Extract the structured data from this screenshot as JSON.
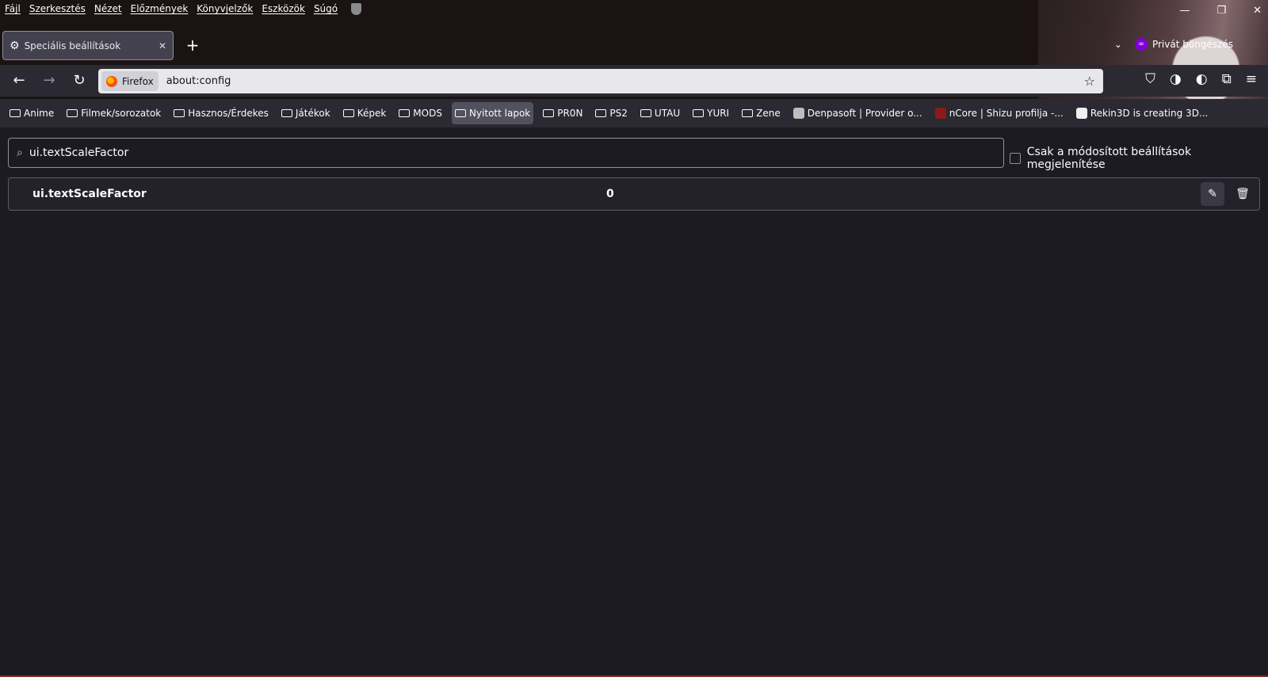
{
  "menubar": {
    "items": [
      "Fájl",
      "Szerkesztés",
      "Nézet",
      "Előzmények",
      "Könyvjelzők",
      "Eszközök",
      "Súgó"
    ]
  },
  "window_controls": {
    "minimize": "—",
    "restore": "❐",
    "close": "✕"
  },
  "tab": {
    "title": "Speciális beállítások",
    "close": "✕"
  },
  "newtab_label": "+",
  "private": {
    "label": "Privát böngészés",
    "chevron": "⌄",
    "mask_glyph": "∞"
  },
  "nav": {
    "back": "←",
    "forward": "→",
    "reload": "↻"
  },
  "urlbar": {
    "identity_label": "Firefox",
    "url": "about:config",
    "star": "☆"
  },
  "toolbar_right": {
    "pocket": "⛉",
    "ext1": "◑",
    "ext2": "◐",
    "extensions": "⧉",
    "menu": "≡"
  },
  "bookmarks": [
    {
      "label": "Anime",
      "type": "folder"
    },
    {
      "label": "Filmek/sorozatok",
      "type": "folder"
    },
    {
      "label": "Hasznos/Érdekes",
      "type": "folder"
    },
    {
      "label": "Játékok",
      "type": "folder"
    },
    {
      "label": "Képek",
      "type": "folder"
    },
    {
      "label": "MODS",
      "type": "folder"
    },
    {
      "label": "Nyitott lapok",
      "type": "folder",
      "active": true
    },
    {
      "label": "PR0N",
      "type": "folder"
    },
    {
      "label": "PS2",
      "type": "folder"
    },
    {
      "label": "UTAU",
      "type": "folder"
    },
    {
      "label": "YURI",
      "type": "folder"
    },
    {
      "label": "Zene",
      "type": "folder"
    },
    {
      "label": "Denpasoft | Provider o...",
      "type": "site",
      "color": "#bdbdbd"
    },
    {
      "label": "nCore | Shizu profilja -...",
      "type": "site",
      "color": "#8b1a1a"
    },
    {
      "label": "Rekin3D is creating 3D...",
      "type": "site",
      "color": "#f0f0f0"
    }
  ],
  "search": {
    "value": "ui.textScaleFactor",
    "icon": "⌕"
  },
  "modified_only_label": "Csak a módosított beállítások megjelenítése",
  "pref": {
    "name": "ui.textScaleFactor",
    "value": "0",
    "edit": "✎",
    "delete": "🗑"
  },
  "colors": {
    "accent_private": "#8000d7",
    "content_bg": "#1c1b22",
    "toolbar_bg": "#2b2a33"
  }
}
